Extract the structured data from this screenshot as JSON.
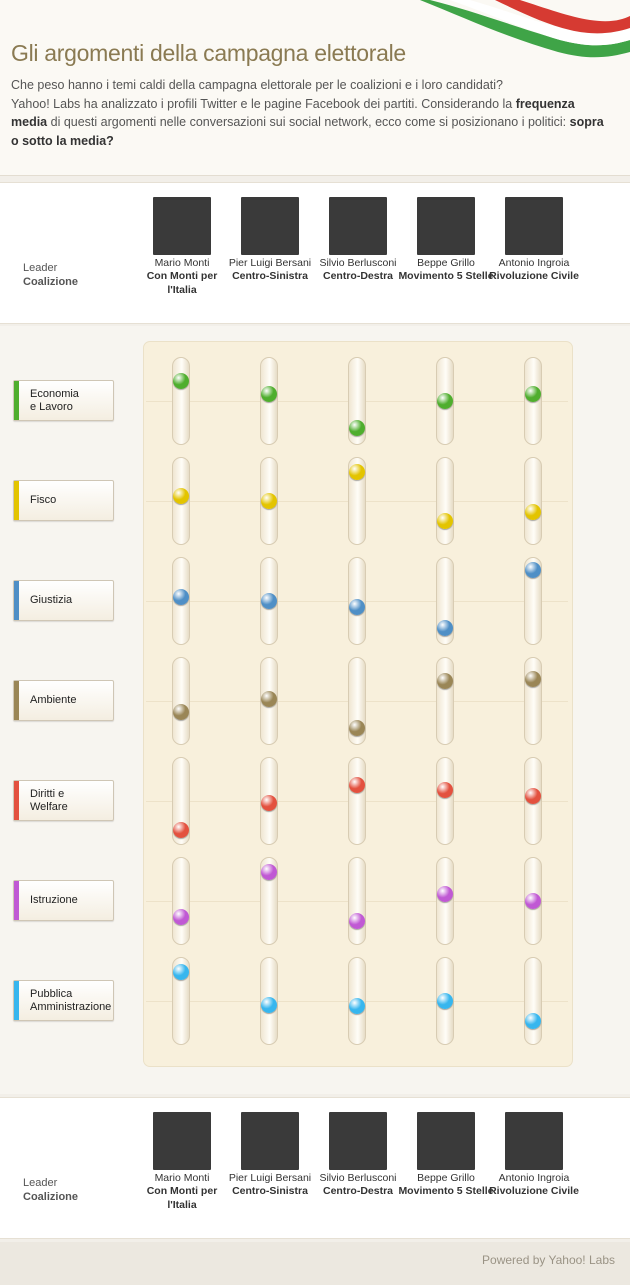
{
  "header": {
    "title": "Gli argomenti della campagna elettorale",
    "intro_line1": "Che peso hanno i temi caldi della campagna elettorale per le coalizioni e i loro candidati?",
    "intro_line2_a": "Yahoo! Labs ha analizzato i profili Twitter e le pagine Facebook dei partiti. Considerando la ",
    "intro_bold1": "frequenza media",
    "intro_line2_b": " di questi argomenti nelle conversazioni sui social network, ecco come si posizionano i politici: ",
    "intro_bold2": "sopra o sotto la media?"
  },
  "row_labels": {
    "leader": "Leader",
    "coalizione": "Coalizione"
  },
  "leaders": [
    {
      "name": "Mario Monti",
      "coalition": "Con Monti per l'Italia"
    },
    {
      "name": "Pier Luigi Bersani",
      "coalition": "Centro-Sinistra"
    },
    {
      "name": "Silvio Berlusconi",
      "coalition": "Centro-Destra"
    },
    {
      "name": "Beppe Grillo",
      "coalition": "Movimento 5 Stelle"
    },
    {
      "name": "Antonio Ingroia",
      "coalition": "Rivoluzione Civile"
    }
  ],
  "chart_data": {
    "type": "scatter",
    "title": "",
    "description_scale": "relative to average frequency (+1 = top, 0 = average, -1 = bottom)",
    "categories": [
      "Mario Monti",
      "Pier Luigi Bersani",
      "Silvio Berlusconi",
      "Beppe Grillo",
      "Antonio Ingroia"
    ],
    "ylim": [
      -1,
      1
    ],
    "series": [
      {
        "name": "Economia\ne Lavoro",
        "color": "#4fae2e",
        "values": [
          0.55,
          0.2,
          -0.75,
          0.0,
          0.2
        ]
      },
      {
        "name": "Fisco",
        "color": "#e3c400",
        "values": [
          0.15,
          0.0,
          0.8,
          -0.55,
          -0.3
        ]
      },
      {
        "name": "Giustizia",
        "color": "#4f8fc6",
        "values": [
          0.1,
          0.0,
          -0.18,
          -0.75,
          0.85
        ]
      },
      {
        "name": "Ambiente",
        "color": "#9a8656",
        "values": [
          -0.3,
          0.05,
          -0.75,
          0.55,
          0.6
        ]
      },
      {
        "name": "Diritti e\nWelfare",
        "color": "#e3513f",
        "values": [
          -0.8,
          -0.05,
          0.45,
          0.3,
          0.15
        ]
      },
      {
        "name": "Istruzione",
        "color": "#c059d4",
        "values": [
          -0.45,
          0.8,
          -0.55,
          0.2,
          0.0
        ]
      },
      {
        "name": "Pubblica\nAmministrazione",
        "color": "#37b6ee",
        "values": [
          0.8,
          -0.1,
          -0.15,
          0.0,
          -0.55
        ]
      }
    ]
  },
  "footer": {
    "powered": "Powered by Yahoo! Labs"
  }
}
